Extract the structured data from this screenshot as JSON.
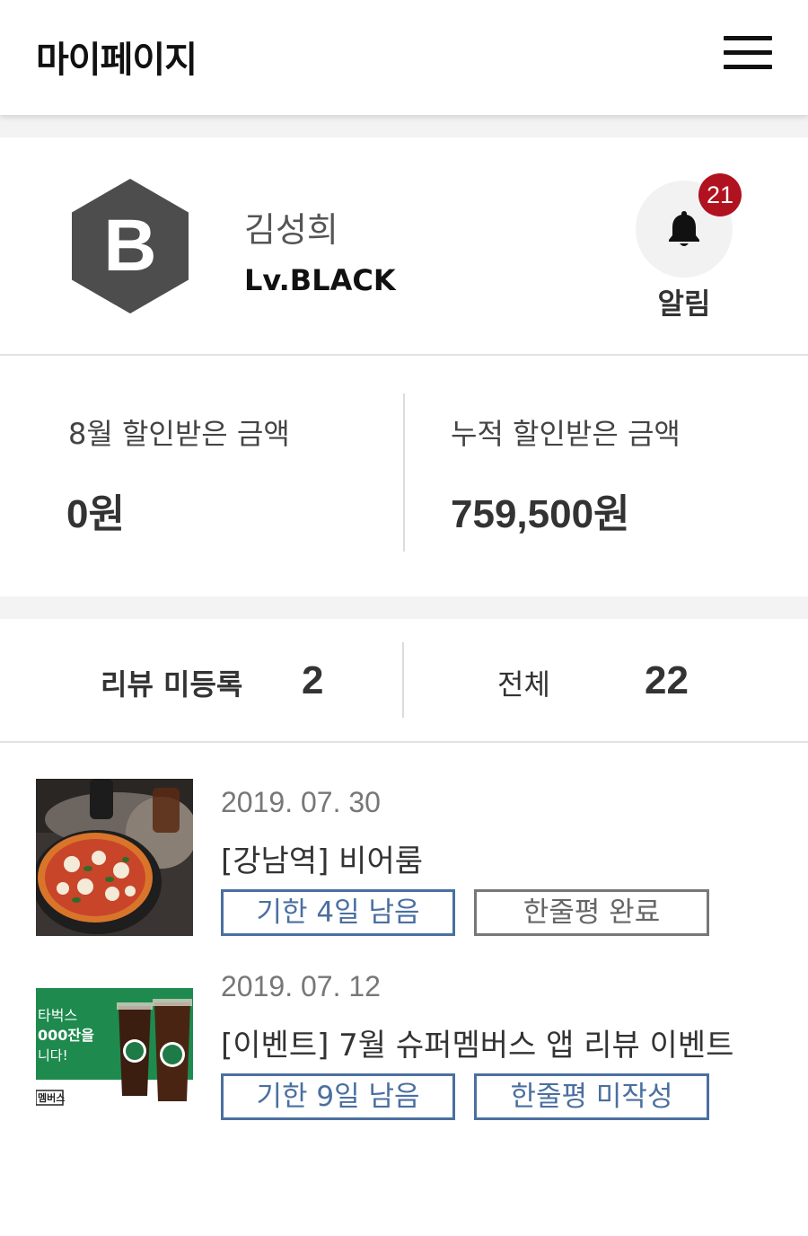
{
  "header": {
    "title": "마이페이지",
    "menu_icon": "hamburger-menu-icon"
  },
  "profile": {
    "badge_letter": "B",
    "badge_color": "#4d4d4d",
    "name": "김성희",
    "level": "Lv.BLACK",
    "notification": {
      "count": "21",
      "label": "알림",
      "badge_color": "#b0121f"
    }
  },
  "discount": {
    "month": {
      "label": "8월 할인받은 금액",
      "value": "0원"
    },
    "total": {
      "label": "누적 할인받은 금액",
      "value": "759,500원"
    }
  },
  "review_summary": {
    "unregistered": {
      "label": "리뷰 미등록",
      "count": "2"
    },
    "all": {
      "label": "전체",
      "count": "22"
    }
  },
  "reviews": [
    {
      "date": "2019. 07. 30",
      "title": "[강남역] 비어룸",
      "deadline": "기한 4일 남음",
      "status": "한줄평 완료",
      "thumb": "pizza-photo"
    },
    {
      "date": "2019. 07. 12",
      "title": "[이벤트] 7월 슈퍼멤버스 앱 리뷰 이벤트",
      "deadline": "기한 9일 남음",
      "status": "한줄평 미작성",
      "thumb": "starbucks-event-banner",
      "banner": {
        "line1": "타벅스",
        "line2": "000잔을",
        "line3": "니다!",
        "line4": "멤버스"
      }
    }
  ],
  "colors": {
    "accent_blue": "#4b6fa0",
    "badge_red": "#b0121f",
    "section_gap": "#f3f3f3"
  }
}
